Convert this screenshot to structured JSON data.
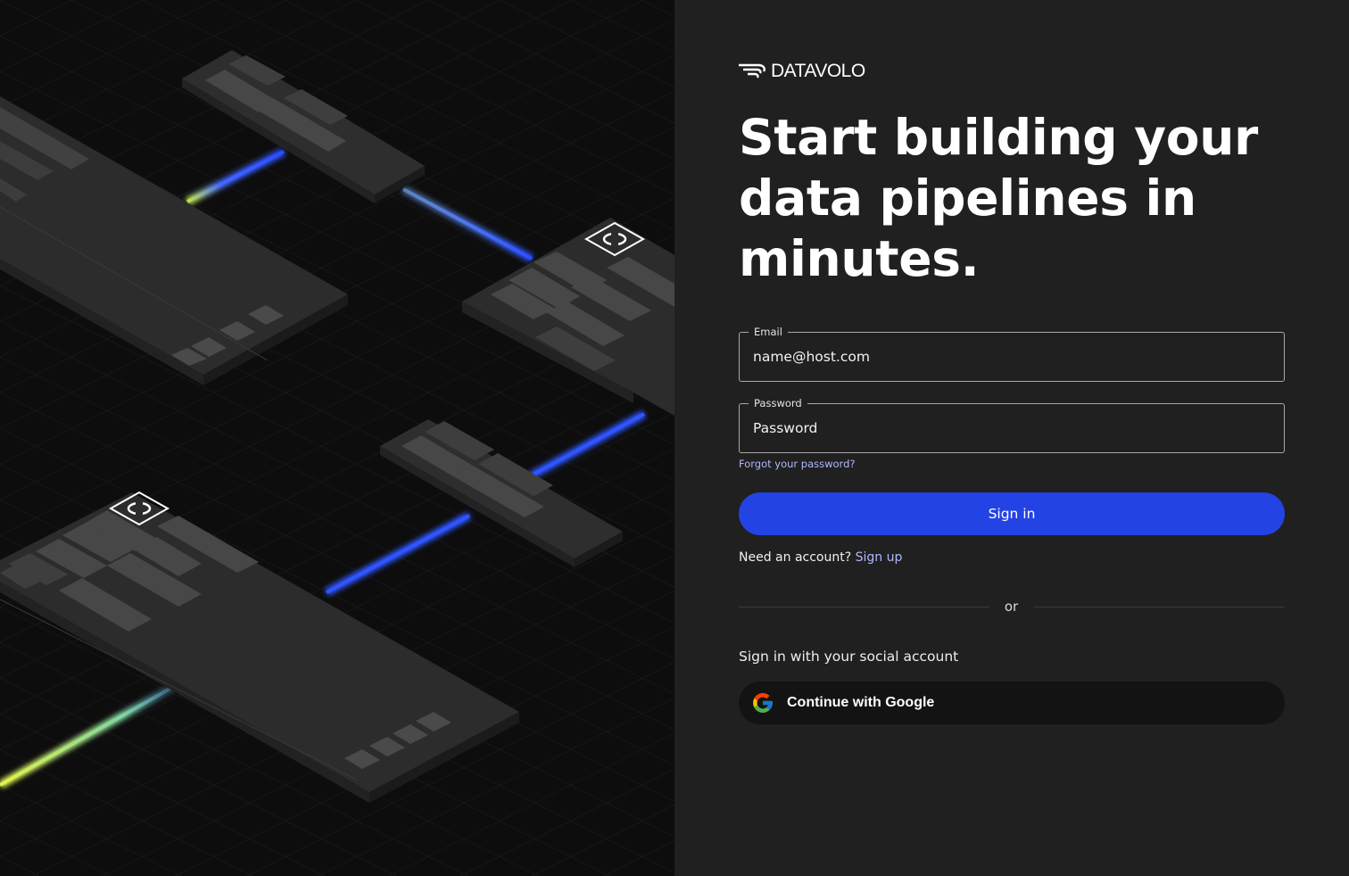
{
  "brand": {
    "name": "DATAVOLO",
    "logo_icon": "datavolo-wing-logo"
  },
  "headline": "Start building your data pipelines in minutes.",
  "form": {
    "email": {
      "label": "Email",
      "placeholder": "name@host.com",
      "value": ""
    },
    "password": {
      "label": "Password",
      "placeholder": "Password",
      "value": ""
    },
    "forgot_link": "Forgot your password?",
    "submit_label": "Sign in"
  },
  "signup": {
    "prompt": "Need an account?",
    "link": "Sign up"
  },
  "divider_text": "or",
  "social": {
    "caption": "Sign in with your social account",
    "google_label": "Continue with Google",
    "google_icon": "google-g-icon"
  },
  "colors": {
    "panel_background": "#202020",
    "illustration_background": "#0d0d0d",
    "primary_button": "#2343e5",
    "link": "#aeb8ff",
    "google_button": "#131313",
    "connector_blue": "#2f55ff",
    "connector_yellow": "#d4ef4a"
  }
}
